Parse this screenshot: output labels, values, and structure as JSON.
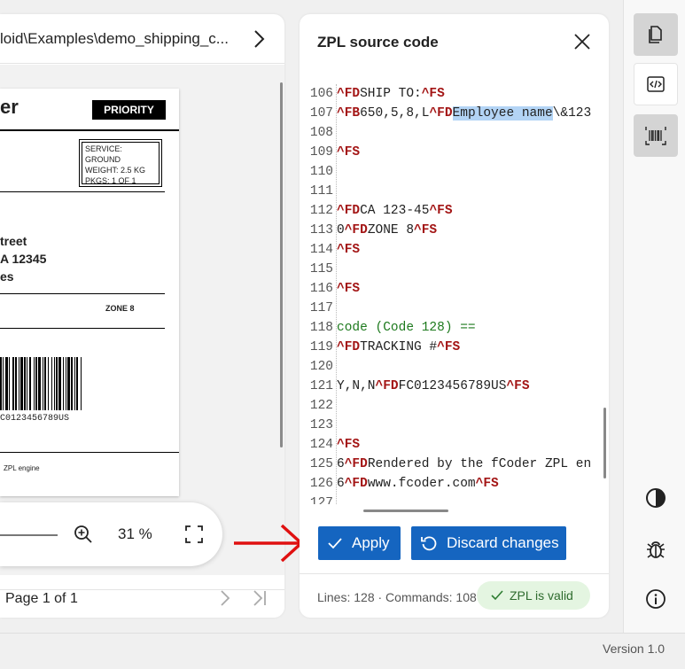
{
  "file_path": "loid\\Examples\\demo_shipping_c...",
  "label": {
    "carrier_tail": "er",
    "priority": "PRIORITY",
    "service": "SERVICE: GROUND",
    "weight": "WEIGHT: 2.5 KG",
    "pkgs": "PKGS: 1 OF 1",
    "addr1": "treet",
    "addr2": "A 12345",
    "addr3": "es",
    "zone": "ZONE 8",
    "tracking": "C0123456789US",
    "engine": "ZPL engine"
  },
  "zoom": {
    "percent": "31 %"
  },
  "pager": {
    "text": "Page 1 of 1"
  },
  "source": {
    "title": "ZPL source code",
    "lines": [
      {
        "n": "106",
        "parts": [
          {
            "t": "^FD",
            "c": "cmd"
          },
          {
            "t": "SHIP TO:",
            "c": ""
          },
          {
            "t": "^FS",
            "c": "cmd"
          }
        ]
      },
      {
        "n": "107",
        "parts": [
          {
            "t": "^FB",
            "c": "cmd"
          },
          {
            "t": "650,5,8,L",
            "c": ""
          },
          {
            "t": "^FD",
            "c": "cmd"
          },
          {
            "t": "Employee name",
            "c": "sel"
          },
          {
            "t": "\\&123",
            "c": ""
          }
        ]
      },
      {
        "n": "108",
        "parts": []
      },
      {
        "n": "109",
        "parts": [
          {
            "t": "^FS",
            "c": "cmd"
          }
        ]
      },
      {
        "n": "110",
        "parts": []
      },
      {
        "n": "111",
        "parts": []
      },
      {
        "n": "112",
        "parts": [
          {
            "t": "^FD",
            "c": "cmd"
          },
          {
            "t": "CA 123-45",
            "c": ""
          },
          {
            "t": "^FS",
            "c": "cmd"
          }
        ]
      },
      {
        "n": "113",
        "parts": [
          {
            "t": "0",
            "c": ""
          },
          {
            "t": "^FD",
            "c": "cmd"
          },
          {
            "t": "ZONE 8",
            "c": ""
          },
          {
            "t": "^FS",
            "c": "cmd"
          }
        ]
      },
      {
        "n": "114",
        "parts": [
          {
            "t": "^FS",
            "c": "cmd"
          }
        ]
      },
      {
        "n": "115",
        "parts": []
      },
      {
        "n": "116",
        "parts": [
          {
            "t": "^FS",
            "c": "cmd"
          }
        ]
      },
      {
        "n": "117",
        "parts": []
      },
      {
        "n": "118",
        "parts": [
          {
            "t": "code (Code 128) ==",
            "c": "cmt"
          }
        ]
      },
      {
        "n": "119",
        "parts": [
          {
            "t": "^FD",
            "c": "cmd"
          },
          {
            "t": "TRACKING #",
            "c": ""
          },
          {
            "t": "^FS",
            "c": "cmd"
          }
        ]
      },
      {
        "n": "120",
        "parts": []
      },
      {
        "n": "121",
        "parts": [
          {
            "t": "Y,N,N",
            "c": ""
          },
          {
            "t": "^FD",
            "c": "cmd"
          },
          {
            "t": "FC0123456789US",
            "c": ""
          },
          {
            "t": "^FS",
            "c": "cmd"
          }
        ]
      },
      {
        "n": "122",
        "parts": []
      },
      {
        "n": "123",
        "parts": []
      },
      {
        "n": "124",
        "parts": [
          {
            "t": "^FS",
            "c": "cmd"
          }
        ]
      },
      {
        "n": "125",
        "parts": [
          {
            "t": "6",
            "c": ""
          },
          {
            "t": "^FD",
            "c": "cmd"
          },
          {
            "t": "Rendered by the fCoder ZPL en",
            "c": ""
          }
        ]
      },
      {
        "n": "126",
        "parts": [
          {
            "t": "6",
            "c": ""
          },
          {
            "t": "^FD",
            "c": "cmd"
          },
          {
            "t": "www.fcoder.com",
            "c": ""
          },
          {
            "t": "^FS",
            "c": "cmd"
          }
        ]
      },
      {
        "n": "127",
        "parts": []
      }
    ],
    "apply_label": "Apply",
    "discard_label": "Discard changes",
    "stats": "Lines: 128 · Commands: 108",
    "valid": "ZPL is valid"
  },
  "version": "Version 1.0",
  "icons": [
    "chevron-right-icon",
    "zoom-in-icon",
    "fit-screen-icon",
    "close-icon",
    "document-icon",
    "code-icon",
    "barcode-icon",
    "contrast-icon",
    "bug-icon",
    "info-icon"
  ],
  "colors": {
    "accent": "#1565c0",
    "command": "#a31515",
    "comment": "#1e7a1e",
    "valid_bg": "#e4f5e1",
    "annotation": "#e01010"
  }
}
